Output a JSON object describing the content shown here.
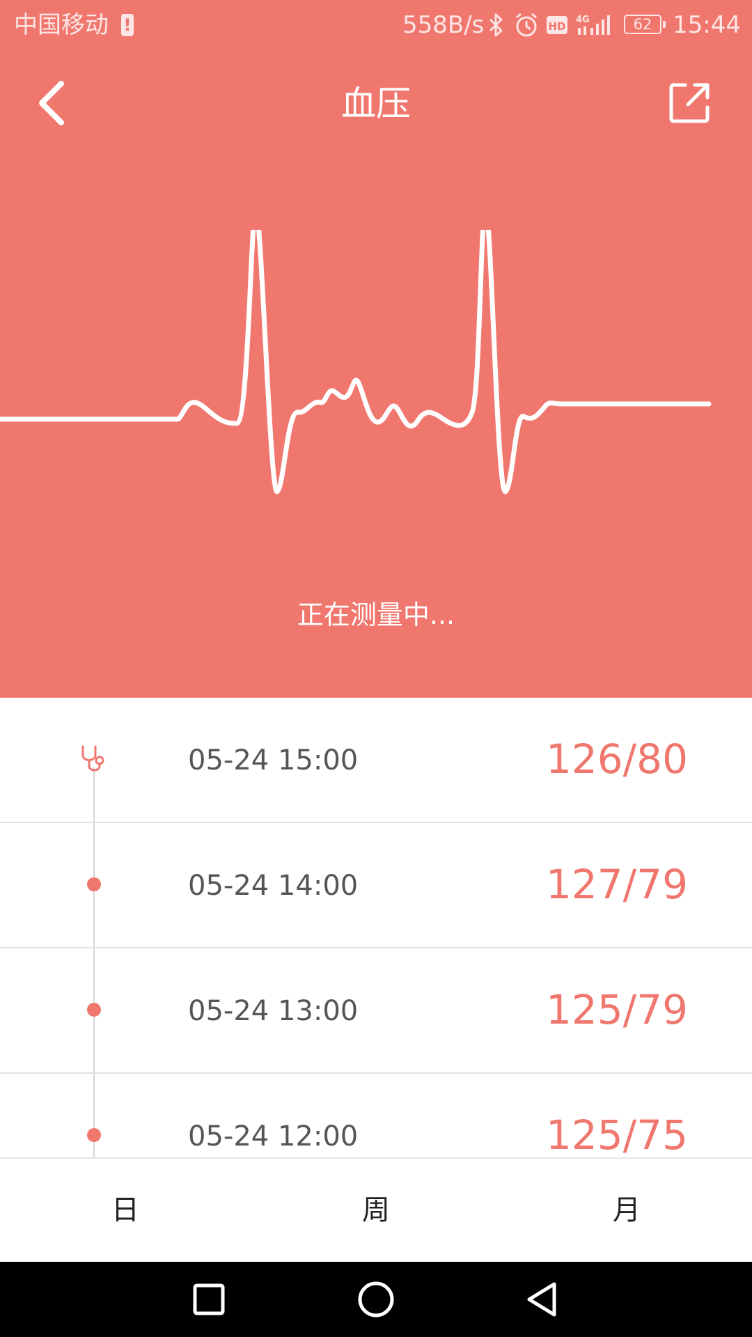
{
  "status_bar": {
    "carrier": "中国移动",
    "net_speed": "558B/s",
    "network": "4G",
    "battery": "62",
    "time": "15:44",
    "icons": [
      "sim-alert-icon",
      "bluetooth-icon",
      "alarm-icon",
      "hd-icon",
      "signal-icon",
      "battery-icon"
    ]
  },
  "header": {
    "title": "血压",
    "back_icon": "chevron-left-icon",
    "share_icon": "share-external-icon"
  },
  "measurement": {
    "status": "正在测量中..."
  },
  "records": [
    {
      "time": "05-24 15:00",
      "value": "126/80",
      "marker": "stethoscope-icon"
    },
    {
      "time": "05-24 14:00",
      "value": "127/79",
      "marker": "dot"
    },
    {
      "time": "05-24 13:00",
      "value": "125/79",
      "marker": "dot"
    },
    {
      "time": "05-24 12:00",
      "value": "125/75",
      "marker": "dot"
    }
  ],
  "tabs": [
    {
      "label": "日"
    },
    {
      "label": "周"
    },
    {
      "label": "月"
    }
  ],
  "nav": {
    "icons": [
      "recent-apps-icon",
      "home-icon",
      "back-triangle-icon"
    ]
  },
  "colors": {
    "accent": "#F0776E",
    "text_gray": "#555555",
    "nav_bg": "#000000"
  }
}
